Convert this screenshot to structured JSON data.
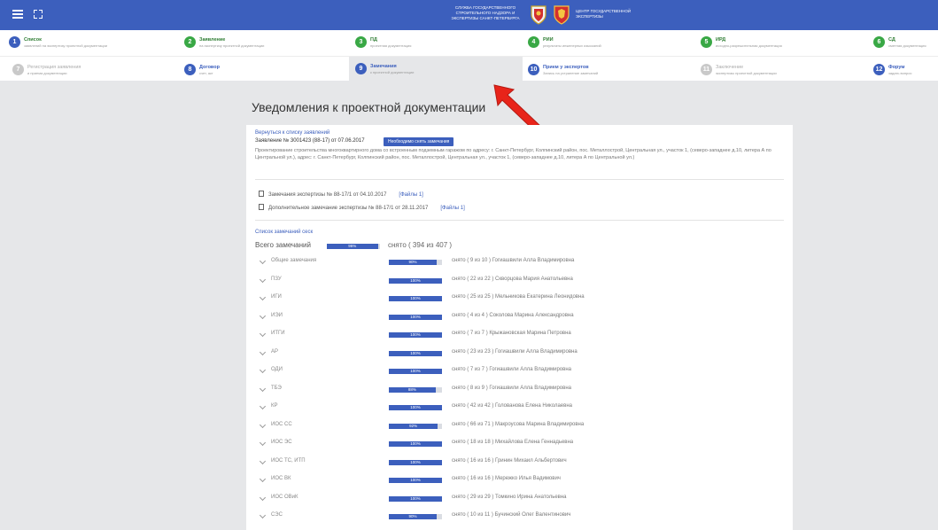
{
  "header": {
    "org_left": "СЛУЖБА ГОСУДАРСТВЕННОГО СТРОИТЕЛЬНОГО НАДЗОРА И ЭКСПЕРТИЗЫ САНКТ-ПЕТЕРБУРГА",
    "org_right": "ЦЕНТР ГОСУДАРСТВЕННОЙ ЭКСПЕРТИЗЫ",
    "accent": "#3c5fbd"
  },
  "steps": [
    {
      "num": "1",
      "title": "Список",
      "sub": "заявлений на экспертизу проектной документации"
    },
    {
      "num": "2",
      "title": "Заявление",
      "sub": "на экспертизу проектной документации"
    },
    {
      "num": "3",
      "title": "ПД",
      "sub": "проектная документация"
    },
    {
      "num": "4",
      "title": "РИИ",
      "sub": "результаты инженерных изысканий"
    },
    {
      "num": "5",
      "title": "ИРД",
      "sub": "исходно-разрешительная документация"
    },
    {
      "num": "6",
      "title": "СД",
      "sub": "сметная документация"
    },
    {
      "num": "7",
      "title": "Регистрация заявления",
      "sub": "и приема документации"
    },
    {
      "num": "8",
      "title": "Договор",
      "sub": "счет, акт"
    },
    {
      "num": "9",
      "title": "Замечания",
      "sub": "к проектной документации"
    },
    {
      "num": "10",
      "title": "Прием у экспертов",
      "sub": "Запись на устранение замечаний"
    },
    {
      "num": "11",
      "title": "Заключение",
      "sub": "экспертизы проектной документации"
    },
    {
      "num": "12",
      "title": "Форум",
      "sub": "задать вопрос"
    }
  ],
  "main": {
    "title": "Уведомления к проектной документации",
    "back_link": "Вернуться к списку заявлений",
    "application": "Заявление № 3001423 (88-17) от 07.06.2017",
    "remove_button": "Необходимо снять замечания",
    "description": "Проектирование строительства многоквартирного дома со встроенным подземным гаражом по адресу: г. Санкт-Петербург, Колпинский район, пос. Металлострой, Центральная ул., участок 1, (северо-западнее д.10, литера А по Центральной ул.), адрес: г. Санкт-Петербург, Колпинский район, пос. Металлострой, Центральная ул., участок 1, (северо-западнее д.10, литера А по Центральной ул.)",
    "docs": [
      {
        "text": "Замечания экспертизы № 88-17/1 от 04.10.2017",
        "files": "[Файлы 1]"
      },
      {
        "text": "Дополнительное замечание экспертизы № 88-17/1 от 28.11.2017",
        "files": "[Файлы 1]"
      }
    ],
    "list_label": "Список замечаний сеск",
    "total_label": "Всего замечаний",
    "total_percent": 96,
    "total_percent_label": "96%",
    "total_text": "снято ( 394 из 407 )"
  },
  "sections": [
    {
      "name": "Общие замечания",
      "percent": 90,
      "label": "90%",
      "info": "снято ( 9 из 10 ) Гогиашвили Алла Владимировна"
    },
    {
      "name": "ПЗУ",
      "percent": 100,
      "label": "100%",
      "info": "снято ( 22 из 22 ) Скворцова Мария Анатольевна"
    },
    {
      "name": "ИГИ",
      "percent": 100,
      "label": "100%",
      "info": "снято ( 25 из 25 ) Мельникова Екатерина Леонидовна"
    },
    {
      "name": "ИЭИ",
      "percent": 100,
      "label": "100%",
      "info": "снято ( 4 из 4 ) Соколова Марина Александровна"
    },
    {
      "name": "ИТГИ",
      "percent": 100,
      "label": "100%",
      "info": "снято ( 7 из 7 ) Крыжановская Марина Петровна"
    },
    {
      "name": "АР",
      "percent": 100,
      "label": "100%",
      "info": "снято ( 23 из 23 ) Гогиашвили Алла Владимировна"
    },
    {
      "name": "ОДИ",
      "percent": 100,
      "label": "100%",
      "info": "снято ( 7 из 7 ) Гогиашвили Алла Владимировна"
    },
    {
      "name": "ТБЭ",
      "percent": 88,
      "label": "88%",
      "info": "снято ( 8 из 9 ) Гогиашвили Алла Владимировна"
    },
    {
      "name": "КР",
      "percent": 100,
      "label": "100%",
      "info": "снято ( 42 из 42 ) Голованова Елена Николаевна"
    },
    {
      "name": "ИОС СС",
      "percent": 92,
      "label": "92%",
      "info": "снято ( 66 из 71 ) Макроусова Марина Владимировна"
    },
    {
      "name": "ИОС ЭС",
      "percent": 100,
      "label": "100%",
      "info": "снято ( 18 из 18 ) Михайлова Елена Геннадьевна"
    },
    {
      "name": "ИОС ТС, ИТП",
      "percent": 100,
      "label": "100%",
      "info": "снято ( 16 из 16 ) Гринин Михаил Альбертович"
    },
    {
      "name": "ИОС ВК",
      "percent": 100,
      "label": "100%",
      "info": "снято ( 16 из 16 ) Мережко Илья Вадимович"
    },
    {
      "name": "ИОС ОВиК",
      "percent": 100,
      "label": "100%",
      "info": "снято ( 29 из 29 ) Томкино Ирина Анатольевна"
    },
    {
      "name": "СЭС",
      "percent": 90,
      "label": "90%",
      "info": "снято ( 10 из 11 ) Бучинский Олег Валентинович"
    }
  ]
}
